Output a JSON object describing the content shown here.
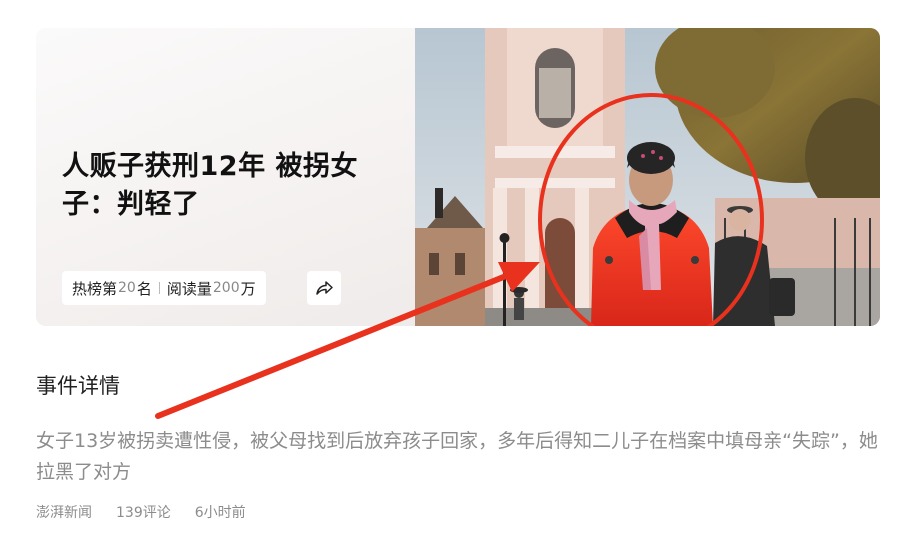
{
  "card": {
    "headline": "人贩子获刑12年 被拐女子：判轻了",
    "rank_label_prefix": "热榜第",
    "rank_number": "20",
    "rank_label_suffix": "名",
    "reads_label": "阅读量",
    "reads_number": "200",
    "reads_unit": "万",
    "share_icon": "share-icon"
  },
  "section": {
    "title": "事件详情"
  },
  "summary": {
    "text": "女子13岁被拐卖遭性侵，被父母找到后放弃孩子回家，多年后得知二儿子在档案中填母亲“失踪”，她拉黑了对方"
  },
  "footer": {
    "source": "澎湃新闻",
    "comments": "139评论",
    "time": "6小时前"
  },
  "annotation": {
    "color": "#e8321e"
  }
}
